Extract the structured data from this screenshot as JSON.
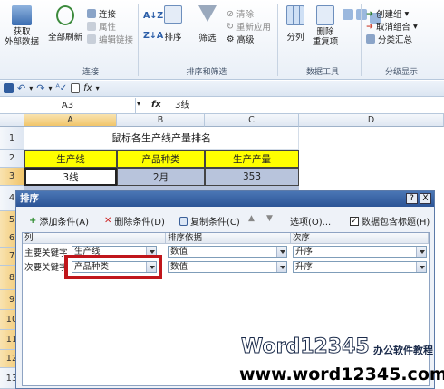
{
  "ribbon": {
    "group_connect": {
      "get_external": "获取\n外部数据",
      "refresh_all": "全部刷新",
      "connections": "连接",
      "properties": "属性",
      "edit_links": "编辑链接",
      "label": "连接"
    },
    "group_sort": {
      "sort": "排序",
      "filter": "筛选",
      "clear": "清除",
      "reapply": "重新应用",
      "advanced": "高级",
      "label": "排序和筛选"
    },
    "group_tools": {
      "text_to_columns": "分列",
      "remove_dup": "删除\n重复项",
      "label": "数据工具"
    },
    "group_outline": {
      "group": "创建组",
      "ungroup": "取消组合",
      "subtotal": "分类汇总",
      "label": "分级显示"
    }
  },
  "formula_bar": {
    "name_box": "A3",
    "fx": "fx",
    "value": "3线"
  },
  "grid": {
    "columns": [
      "A",
      "B",
      "C",
      "D"
    ],
    "rows": [
      "1",
      "2",
      "3",
      "4",
      "5",
      "6",
      "7",
      "8",
      "9",
      "10",
      "11",
      "12",
      "13"
    ],
    "title": "鼠标各生产线产量排名",
    "headers": [
      "生产线",
      "产品种类",
      "生产产量"
    ],
    "row3": [
      "3线",
      "2月",
      "353"
    ]
  },
  "dialog": {
    "title": "排序",
    "help": "?",
    "close": "X",
    "add_level": "添加条件(A)",
    "delete_level": "删除条件(D)",
    "copy_level": "复制条件(C)",
    "options": "选项(O)...",
    "has_header": "数据包含标题(H)",
    "col_header": "列",
    "sort_on_header": "排序依据",
    "order_header": "次序",
    "row1": {
      "label": "主要关键字",
      "column": "生产线",
      "sort_on": "数值",
      "order": "升序"
    },
    "row2": {
      "label": "次要关键字",
      "column": "产品种类",
      "sort_on": "数值",
      "order": "升序"
    }
  },
  "watermark": {
    "brand": "Word12345",
    "tagline": "办公软件教程",
    "url": "www.word12345.com"
  },
  "colors": {
    "yellow": "#ffff00",
    "blue_fill": "#b8c4dc",
    "highlight_red": "#c0161b"
  }
}
